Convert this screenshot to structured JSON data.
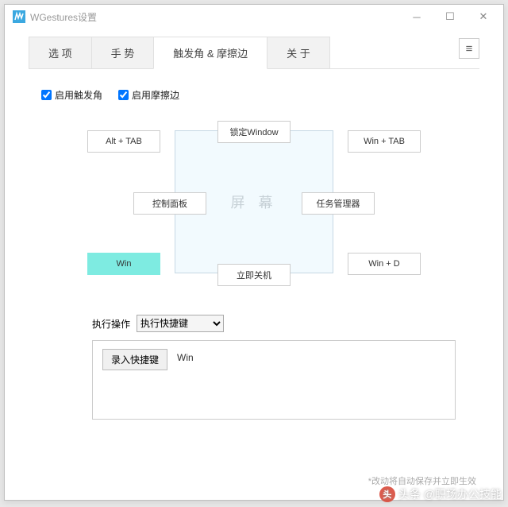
{
  "window": {
    "title": "WGestures设置"
  },
  "tabs": {
    "options": "选 项",
    "gestures": "手 势",
    "corners": "触发角 & 摩擦边",
    "about": "关 于"
  },
  "checkboxes": {
    "enable_corners": "启用触发角",
    "enable_edges": "启用摩擦边"
  },
  "screen_label": "屏 幕",
  "slots": {
    "top_left": "Alt + TAB",
    "top_center": "锁定Window",
    "top_right": "Win + TAB",
    "mid_left": "控制面板",
    "mid_right": "任务管理器",
    "bottom_left": "Win",
    "bottom_center": "立即关机",
    "bottom_right": "Win + D"
  },
  "action": {
    "label": "执行操作",
    "selected": "执行快捷键"
  },
  "record": {
    "button": "录入快捷键",
    "value": "Win"
  },
  "footnote": "*改动将自动保存并立即生效",
  "watermark": "头条 @职场办公技能"
}
